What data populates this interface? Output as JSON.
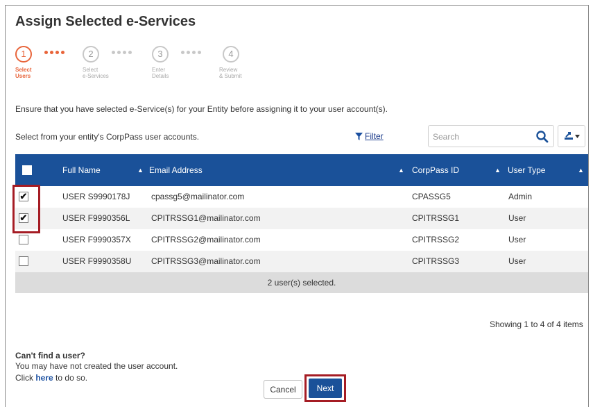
{
  "page": {
    "title": "Assign Selected e-Services"
  },
  "stepper": {
    "steps": [
      {
        "number": "1",
        "label_1": "Select",
        "label_2": "Users"
      },
      {
        "number": "2",
        "label_1": "Select",
        "label_2": "e-Services"
      },
      {
        "number": "3",
        "label_1": "Enter",
        "label_2": "Details"
      },
      {
        "number": "4",
        "label_1": "Review",
        "label_2": "& Submit"
      }
    ],
    "active_step": 1,
    "active_color": "#e8643a"
  },
  "instruction": "Ensure that you have selected e-Service(s) for your Entity before assigning it to your user account(s).",
  "select_prompt": "Select from your entity's CorpPass user accounts.",
  "toolbar": {
    "filter_label": "Filter",
    "search_placeholder": "Search",
    "search_icon": "search-icon",
    "export_icon": "export-icon"
  },
  "table": {
    "header_color": "#1a5199",
    "columns": [
      "Full Name",
      "Email Address",
      "CorpPass ID",
      "User Type"
    ],
    "rows": [
      {
        "checked": true,
        "checkmark": "✔",
        "full_name": "USER S9990178J",
        "email": "cpassg5@mailinator.com",
        "corppass_id": "CPASSG5",
        "user_type": "Admin"
      },
      {
        "checked": true,
        "checkmark": "✔",
        "full_name": "USER F9990356L",
        "email": "CPITRSSG1@mailinator.com",
        "corppass_id": "CPITRSSG1",
        "user_type": "User"
      },
      {
        "checked": false,
        "checkmark": "",
        "full_name": "USER F9990357X",
        "email": "CPITRSSG2@mailinator.com",
        "corppass_id": "CPITRSSG2",
        "user_type": "User"
      },
      {
        "checked": false,
        "checkmark": "",
        "full_name": "USER F9990358U",
        "email": "CPITRSSG3@mailinator.com",
        "corppass_id": "CPITRSSG3",
        "user_type": "User"
      }
    ],
    "footer": "2 user(s) selected."
  },
  "pagination_info": "Showing 1 to 4 of 4 items",
  "help": {
    "heading": "Can't find a user?",
    "line1": "You may have not created the user account.",
    "line2_prefix": "Click",
    "line2_link": "here",
    "line2_suffix": "to do so."
  },
  "actions": {
    "cancel_label": "Cancel",
    "next_label": "Next"
  },
  "highlight_color": "#a51c24"
}
